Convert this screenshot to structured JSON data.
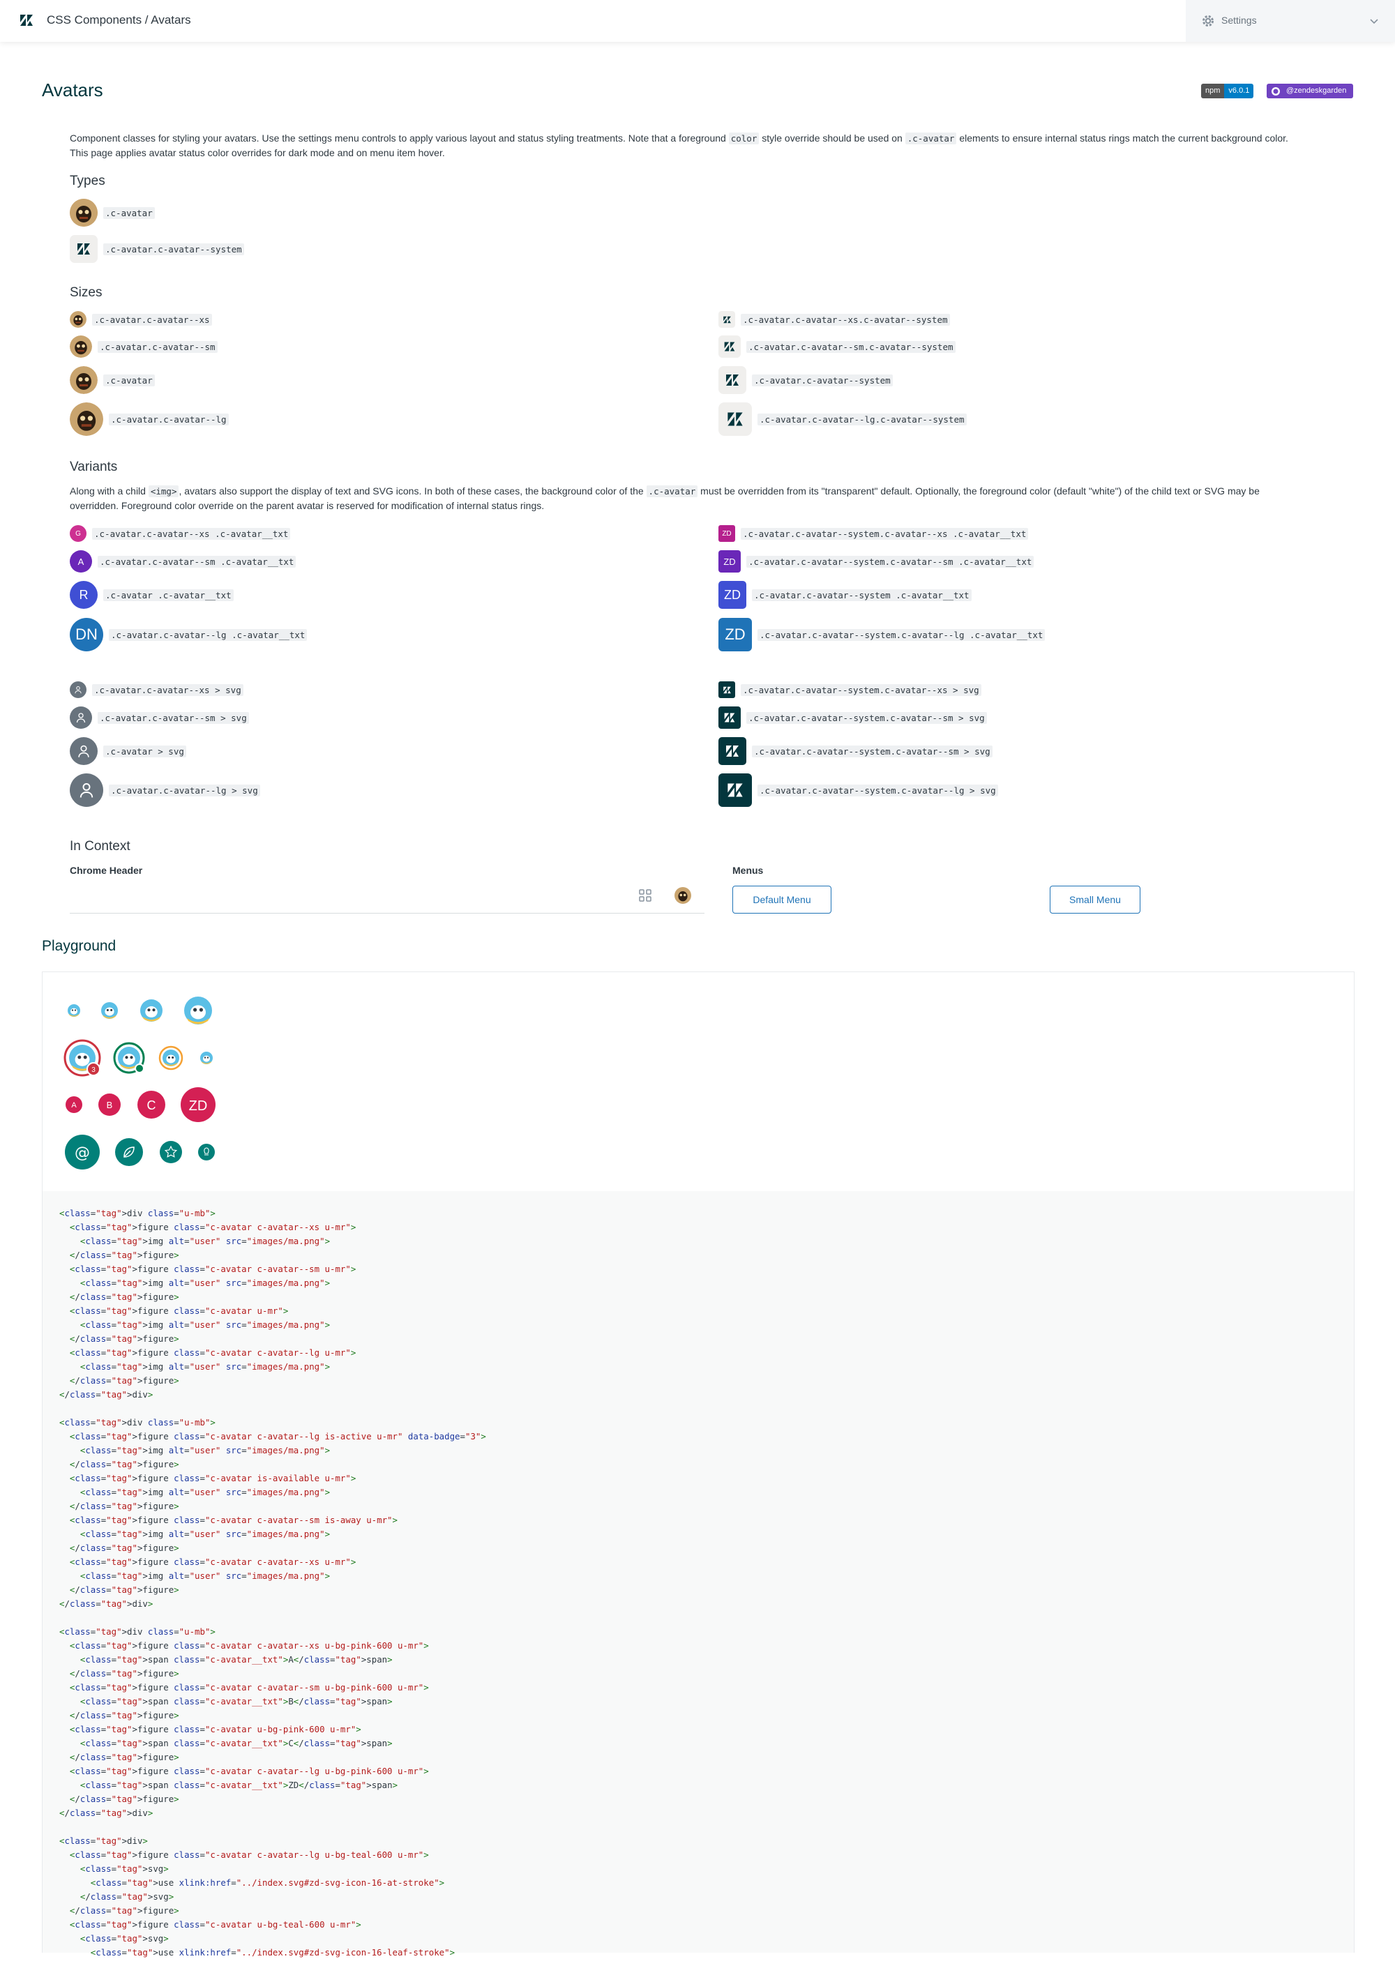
{
  "header": {
    "brand": "CSS Components / Avatars",
    "settings_label": "Settings"
  },
  "page": {
    "title": "Avatars",
    "npm_label": "npm",
    "npm_version": "v6.0.1",
    "github_label": "@zendeskgarden"
  },
  "intro": {
    "p1_a": "Component classes for styling your avatars. Use the settings menu controls to apply various layout and status styling treatments. Note that a foreground",
    "p1_code1": "color",
    "p1_b": "style override should be used on",
    "p1_code2": ".c-avatar",
    "p1_c": "elements to ensure internal status rings match the current background color.",
    "p2": "This page applies avatar status color overrides for dark mode and on menu item hover."
  },
  "types": {
    "heading": "Types",
    "items": [
      ".c-avatar",
      ".c-avatar.c-avatar--system"
    ]
  },
  "sizes": {
    "heading": "Sizes",
    "left": [
      ".c-avatar.c-avatar--xs",
      ".c-avatar.c-avatar--sm",
      ".c-avatar",
      ".c-avatar.c-avatar--lg"
    ],
    "right": [
      ".c-avatar.c-avatar--xs.c-avatar--system",
      ".c-avatar.c-avatar--sm.c-avatar--system",
      ".c-avatar.c-avatar--system",
      ".c-avatar.c-avatar--lg.c-avatar--system"
    ]
  },
  "variants": {
    "heading": "Variants",
    "text_a": "Along with a child",
    "code_img": "<img>",
    "text_b": ", avatars also support the display of text and SVG icons. In both of these cases, the background color of the",
    "code_av": ".c-avatar",
    "text_c": "must be overridden from its \"transparent\" default. Optionally, the foreground color (default \"white\") of the child text or SVG may be",
    "text_d": "overridden. Foreground color override on the parent avatar is reserved for modification of internal status rings.",
    "txt_left": [
      {
        "initials": "G",
        "code": ".c-avatar.c-avatar--xs .c-avatar__txt"
      },
      {
        "initials": "A",
        "code": ".c-avatar.c-avatar--sm .c-avatar__txt"
      },
      {
        "initials": "R",
        "code": ".c-avatar .c-avatar__txt"
      },
      {
        "initials": "DN",
        "code": ".c-avatar.c-avatar--lg .c-avatar__txt"
      }
    ],
    "txt_right": [
      {
        "initials": "ZD",
        "code": ".c-avatar.c-avatar--system.c-avatar--xs .c-avatar__txt"
      },
      {
        "initials": "ZD",
        "code": ".c-avatar.c-avatar--system.c-avatar--sm .c-avatar__txt"
      },
      {
        "initials": "ZD",
        "code": ".c-avatar.c-avatar--system .c-avatar__txt"
      },
      {
        "initials": "ZD",
        "code": ".c-avatar.c-avatar--system.c-avatar--lg .c-avatar__txt"
      }
    ],
    "svg_left": [
      ".c-avatar.c-avatar--xs > svg",
      ".c-avatar.c-avatar--sm > svg",
      ".c-avatar > svg",
      ".c-avatar.c-avatar--lg > svg"
    ],
    "svg_right": [
      ".c-avatar.c-avatar--system.c-avatar--xs > svg",
      ".c-avatar.c-avatar--system.c-avatar--sm > svg",
      ".c-avatar.c-avatar--system.c-avatar--sm > svg",
      ".c-avatar.c-avatar--system.c-avatar--lg > svg"
    ]
  },
  "context": {
    "heading": "In Context",
    "chrome_header": "Chrome Header",
    "menus": "Menus",
    "default_menu": "Default Menu",
    "small_menu": "Small Menu"
  },
  "playground": {
    "heading": "Playground",
    "badge_count": "3",
    "letters": [
      "A",
      "B",
      "C",
      "ZD"
    ],
    "code_lines": [
      "<div class=\"u-mb\">",
      "  <figure class=\"c-avatar c-avatar--xs u-mr\">",
      "    <img alt=\"user\" src=\"images/ma.png\">",
      "  </figure>",
      "  <figure class=\"c-avatar c-avatar--sm u-mr\">",
      "    <img alt=\"user\" src=\"images/ma.png\">",
      "  </figure>",
      "  <figure class=\"c-avatar u-mr\">",
      "    <img alt=\"user\" src=\"images/ma.png\">",
      "  </figure>",
      "  <figure class=\"c-avatar c-avatar--lg u-mr\">",
      "    <img alt=\"user\" src=\"images/ma.png\">",
      "  </figure>",
      "</div>",
      "",
      "<div class=\"u-mb\">",
      "  <figure class=\"c-avatar c-avatar--lg is-active u-mr\" data-badge=\"3\">",
      "    <img alt=\"user\" src=\"images/ma.png\">",
      "  </figure>",
      "  <figure class=\"c-avatar is-available u-mr\">",
      "    <img alt=\"user\" src=\"images/ma.png\">",
      "  </figure>",
      "  <figure class=\"c-avatar c-avatar--sm is-away u-mr\">",
      "    <img alt=\"user\" src=\"images/ma.png\">",
      "  </figure>",
      "  <figure class=\"c-avatar c-avatar--xs u-mr\">",
      "    <img alt=\"user\" src=\"images/ma.png\">",
      "  </figure>",
      "</div>",
      "",
      "<div class=\"u-mb\">",
      "  <figure class=\"c-avatar c-avatar--xs u-bg-pink-600 u-mr\">",
      "    <span class=\"c-avatar__txt\">A</span>",
      "  </figure>",
      "  <figure class=\"c-avatar c-avatar--sm u-bg-pink-600 u-mr\">",
      "    <span class=\"c-avatar__txt\">B</span>",
      "  </figure>",
      "  <figure class=\"c-avatar u-bg-pink-600 u-mr\">",
      "    <span class=\"c-avatar__txt\">C</span>",
      "  </figure>",
      "  <figure class=\"c-avatar c-avatar--lg u-bg-pink-600 u-mr\">",
      "    <span class=\"c-avatar__txt\">ZD</span>",
      "  </figure>",
      "</div>",
      "",
      "<div>",
      "  <figure class=\"c-avatar c-avatar--lg u-bg-teal-600 u-mr\">",
      "    <svg>",
      "      <use xlink:href=\"../index.svg#zd-svg-icon-16-at-stroke\">",
      "    </svg>",
      "  </figure>",
      "  <figure class=\"c-avatar u-bg-teal-600 u-mr\">",
      "    <svg>",
      "      <use xlink:href=\"../index.svg#zd-svg-icon-16-leaf-stroke\">"
    ]
  },
  "colors": {
    "txt_left": [
      "#cd3091",
      "#6a27b8",
      "#3f4fd4",
      "#1f73b7"
    ],
    "txt_right": [
      "#b5208d",
      "#6a27b8",
      "#3f4fd4",
      "#1f73b7"
    ],
    "pink": "#d42054",
    "teal": "#028079",
    "dark": "#03363d",
    "grey": "#68737d"
  }
}
